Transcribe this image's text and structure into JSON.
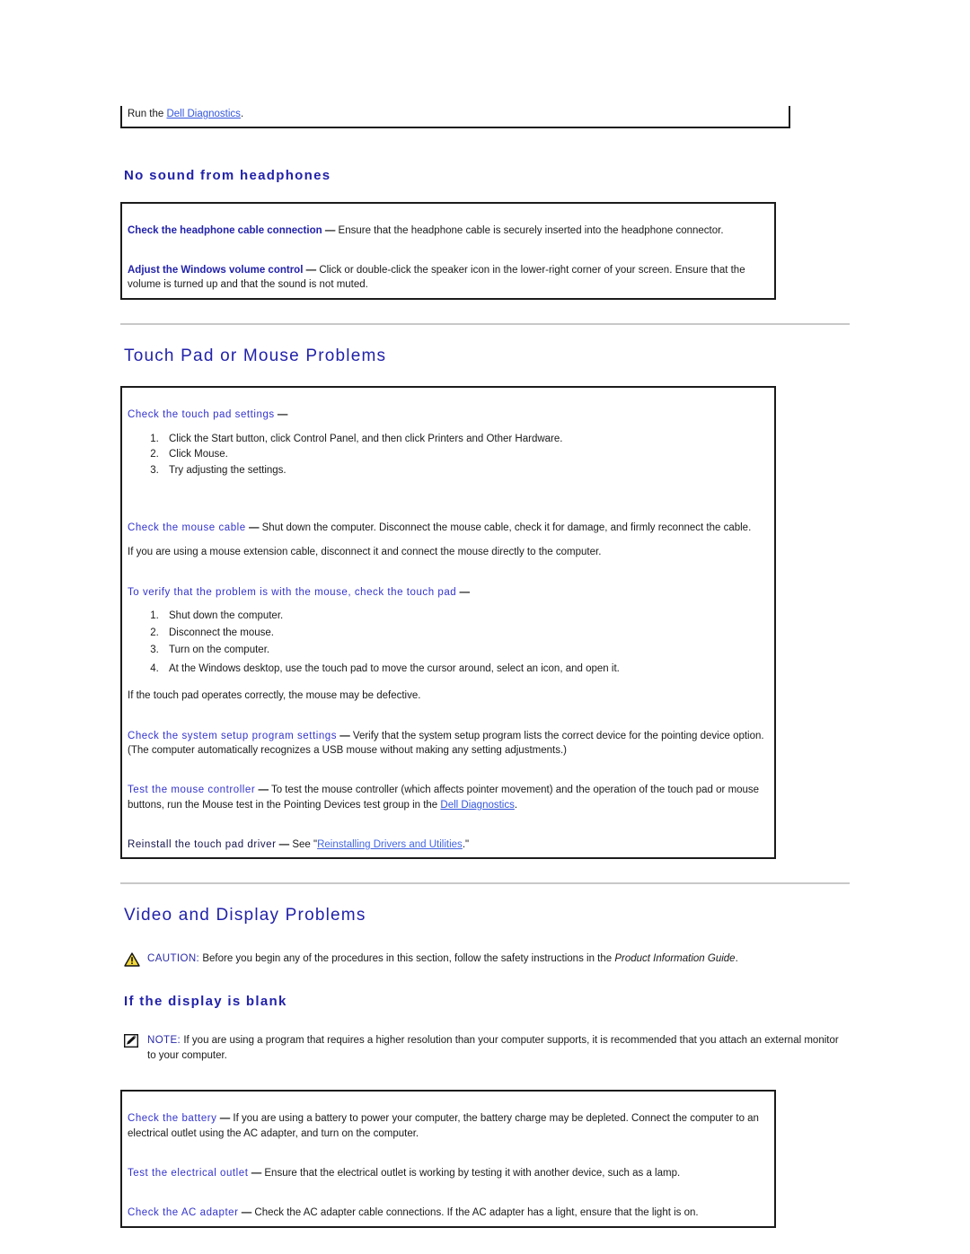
{
  "document": {
    "top_fragment": {
      "text_before_link": "Run the ",
      "link": "Dell Diagnostics",
      "text_after_link": "."
    },
    "sections": [
      {
        "id": "no-sound-headphones",
        "heading": "No sound from headphones",
        "heading_level": "sub",
        "tips": [
          {
            "lead": "Check the headphone cable connection",
            "lead_style": "bold",
            "dash": "—",
            "body": "Ensure that the headphone cable is securely inserted into the headphone connector."
          },
          {
            "lead": "Adjust the Windows volume control",
            "lead_style": "bold",
            "dash": "—",
            "body": "Click or double-click the speaker icon in the lower-right corner of your screen. Ensure that the volume is turned up and that the sound is not muted."
          }
        ]
      },
      {
        "id": "touch-pad-mouse",
        "heading": "Touch Pad or Mouse Problems",
        "heading_level": "section",
        "tips": [
          {
            "lead": "Check the touch pad settings",
            "lead_style": "blue",
            "dash": "—",
            "body": "",
            "steps": [
              "Click the Start button, click Control Panel, and then click Printers and Other Hardware.",
              "Click Mouse.",
              "Try adjusting the settings."
            ]
          },
          {
            "lead": "Check the mouse cable",
            "lead_style": "blue",
            "dash": "—",
            "body": "Shut down the computer. Disconnect the mouse cable, check it for damage, and firmly reconnect the cable.",
            "extra": "If you are using a mouse extension cable, disconnect it and connect the mouse directly to the computer."
          },
          {
            "lead": "To verify that the problem is with the mouse, check the touch pad",
            "lead_style": "blue",
            "dash": "—",
            "body": "",
            "steps": [
              "Shut down the computer.",
              "Disconnect the mouse.",
              "Turn on the computer.",
              "At the Windows desktop, use the touch pad to move the cursor around, select an icon, and open it."
            ],
            "extra": "If the touch pad operates correctly, the mouse may be defective."
          },
          {
            "lead": "Check the system setup program settings",
            "lead_style": "blue",
            "dash": "—",
            "body": "Verify that the system setup program lists the correct device for the pointing device option. (The computer automatically recognizes a USB mouse without making any setting adjustments.)"
          },
          {
            "lead": "Test the mouse controller",
            "lead_style": "blue",
            "dash": "—",
            "body_pre_link": "To test the mouse controller (which affects pointer movement) and the operation of the touch pad or mouse buttons, run the Mouse test in the Pointing Devices test group in the ",
            "link": "Dell Diagnostics",
            "body_post_link": "."
          },
          {
            "lead": "Reinstall the touch pad driver",
            "lead_style": "dark",
            "dash": "—",
            "body_pre_link": "See \"",
            "link": "Reinstalling Drivers and Utilities",
            "body_post_link": ".\""
          }
        ]
      },
      {
        "id": "video-display",
        "heading": "Video and Display Problems",
        "heading_level": "section",
        "caution": {
          "icon": "warning-triangle-icon",
          "label": "CAUTION:",
          "text_before_italic": " Before you begin any of the procedures in this section, follow the safety instructions in the ",
          "italic": "Product Information Guide",
          "text_after_italic": "."
        },
        "subsections": [
          {
            "id": "display-blank",
            "heading": "If the display is blank",
            "heading_level": "sub",
            "note": {
              "icon": "note-pencil-icon",
              "label": "NOTE:",
              "text": " If you are using a program that requires a higher resolution than your computer supports, it is recommended that you attach an external monitor to your computer."
            },
            "tips": [
              {
                "lead": "Check the battery",
                "lead_style": "blue",
                "dash": "—",
                "body": "If you are using a battery to power your computer, the battery charge may be depleted. Connect the computer to an electrical outlet using the AC adapter, and turn on the computer."
              },
              {
                "lead": "Test the electrical outlet",
                "lead_style": "blue",
                "dash": "—",
                "body": "Ensure that the electrical outlet is working by testing it with another device, such as a lamp."
              },
              {
                "lead": "Check the AC adapter",
                "lead_style": "blue",
                "dash": "—",
                "body": "Check the AC adapter cable connections. If the AC adapter has a light, ensure that the light is on."
              }
            ]
          }
        ]
      }
    ],
    "colors": {
      "heading_blue": "#2222aa",
      "link_blue": "#3355dd",
      "lead_blue": "#3333cc",
      "lead_dark": "#15154d",
      "border_black": "#1b1b1b",
      "rule_gray": "#c8c8c8",
      "caution_yellow": "#f2d83c"
    }
  }
}
